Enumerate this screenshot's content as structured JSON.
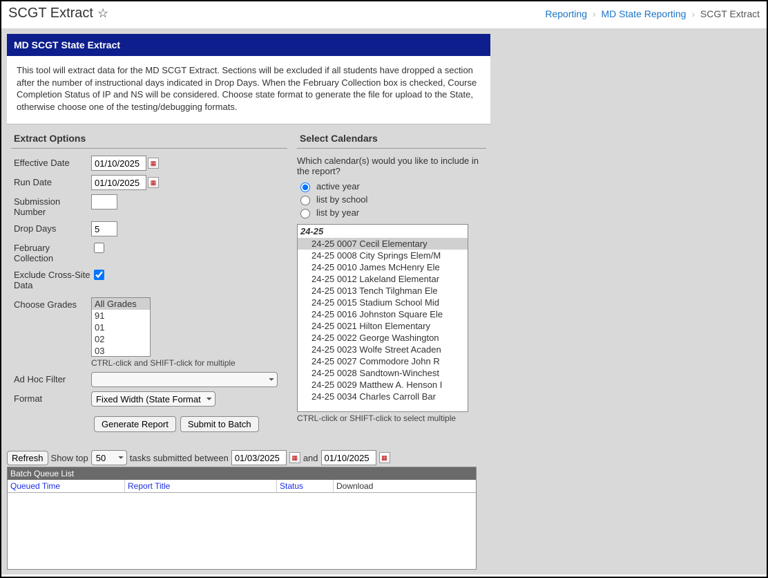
{
  "page": {
    "title": "SCGT Extract"
  },
  "breadcrumb": {
    "link1": "Reporting",
    "link2": "MD State Reporting",
    "current": "SCGT Extract"
  },
  "panel": {
    "header": "MD SCGT State Extract",
    "description": "This tool will extract data for the MD SCGT Extract. Sections will be excluded if all students have dropped a section after the number of instructional days indicated in Drop Days. When the February Collection box is checked, Course Completion Status of IP and NS will be considered. Choose state format to generate the file for upload to the State, otherwise choose one of the testing/debugging formats."
  },
  "extract": {
    "title": "Extract Options",
    "effective_date_label": "Effective Date",
    "effective_date": "01/10/2025",
    "run_date_label": "Run Date",
    "run_date": "01/10/2025",
    "submission_label": "Submission Number",
    "submission": "",
    "drop_days_label": "Drop Days",
    "drop_days": "5",
    "feb_label": "February Collection",
    "exclude_label": "Exclude Cross-Site Data",
    "grades_label": "Choose Grades",
    "grades": [
      "All Grades",
      "91",
      "01",
      "02",
      "03"
    ],
    "grades_hint": "CTRL-click and SHIFT-click for multiple",
    "adhoc_label": "Ad Hoc Filter",
    "format_label": "Format",
    "format_value": "Fixed Width (State Format)",
    "generate_btn": "Generate Report",
    "submit_btn": "Submit to Batch"
  },
  "calendars": {
    "title": "Select Calendars",
    "question": "Which calendar(s) would you like to include in the report?",
    "r1": "active year",
    "r2": "list by school",
    "r3": "list by year",
    "group": "24-25",
    "items": [
      "24-25 0007 Cecil Elementary",
      "24-25 0008 City Springs Elem/M",
      "24-25 0010 James McHenry Ele",
      "24-25 0012 Lakeland Elementar",
      "24-25 0013 Tench Tilghman Ele",
      "24-25 0015 Stadium School Mid",
      "24-25 0016 Johnston Square Ele",
      "24-25 0021 Hilton Elementary",
      "24-25 0022 George Washington",
      "24-25 0023 Wolfe Street Acaden",
      "24-25 0027 Commodore John R",
      "24-25 0028 Sandtown-Winchest",
      "24-25 0029 Matthew A. Henson I",
      "24-25 0034 Charles Carroll Bar"
    ],
    "hint": "CTRL-click or SHIFT-click to select multiple"
  },
  "queue": {
    "refresh": "Refresh",
    "show_top": "Show top",
    "top_value": "50",
    "between_1": "tasks submitted between",
    "date_from": "01/03/2025",
    "and": "and",
    "date_to": "01/10/2025",
    "list_title": "Batch Queue List",
    "col_qt": "Queued Time",
    "col_rt": "Report Title",
    "col_st": "Status",
    "col_dl": "Download"
  }
}
